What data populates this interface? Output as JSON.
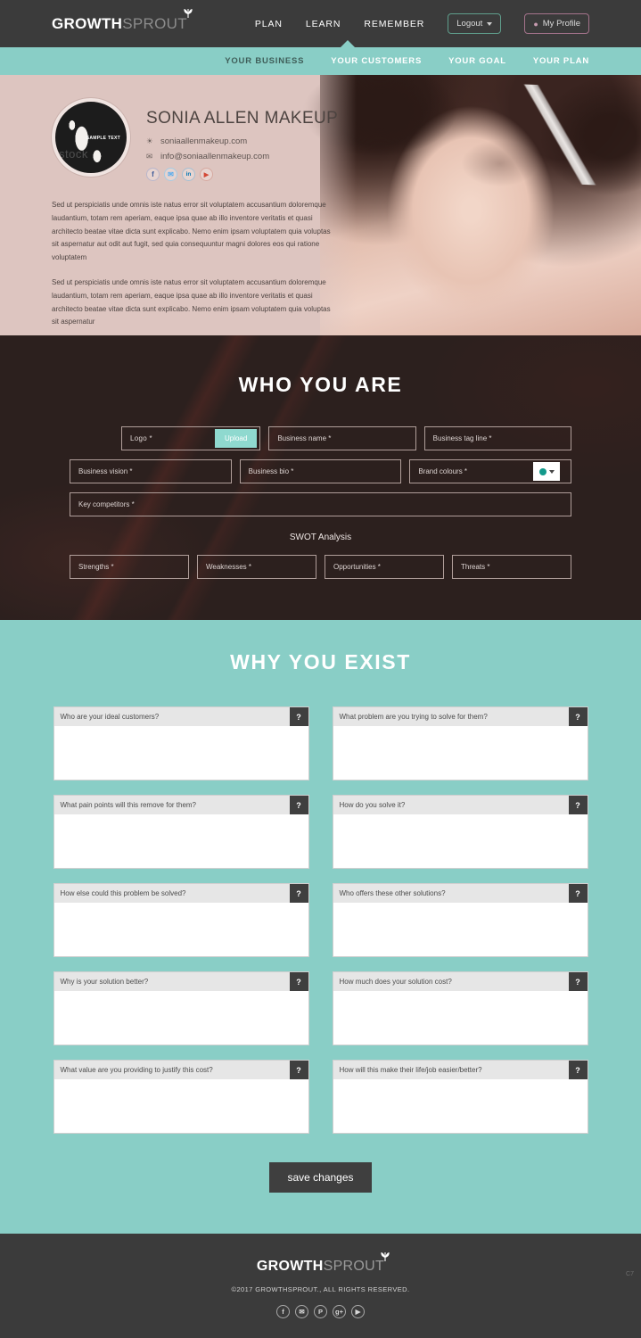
{
  "brand": {
    "logo_bold": "GROWTH",
    "logo_light": "SPROUT",
    "accent_teal": "#89cec6",
    "accent_dark": "#3b3b3b",
    "accent_maroon": "#2c201e",
    "swatch_color": "#12998b"
  },
  "topnav": {
    "links": [
      {
        "label": "PLAN",
        "active": true
      },
      {
        "label": "LEARN",
        "active": false
      },
      {
        "label": "REMEMBER",
        "active": false
      }
    ],
    "logout_label": "Logout",
    "profile_label": "My Profile"
  },
  "subnav": {
    "items": [
      {
        "label": "YOUR BUSINESS",
        "active": true
      },
      {
        "label": "YOUR CUSTOMERS",
        "active": false
      },
      {
        "label": "YOUR GOAL",
        "active": false
      },
      {
        "label": "YOUR PLAN",
        "active": false
      }
    ]
  },
  "profile": {
    "business_name": "SONIA ALLEN MAKEUP",
    "website": "soniaallenmakeup.com",
    "email": "info@soniaallenmakeup.com",
    "avatar_sample_text": "SAMPLE TEXT",
    "socials": [
      {
        "name": "facebook",
        "glyph": "f"
      },
      {
        "name": "twitter",
        "glyph": "✉"
      },
      {
        "name": "linkedin",
        "glyph": "in"
      },
      {
        "name": "youtube",
        "glyph": "▶"
      }
    ],
    "paragraphs": [
      "Sed ut perspiciatis unde omnis iste natus error sit voluptatem accusantium doloremque laudantium, totam rem aperiam, eaque ipsa quae ab illo inventore veritatis et quasi architecto beatae vitae dicta sunt explicabo. Nemo enim ipsam voluptatem quia voluptas sit aspernatur aut odit aut fugit, sed quia consequuntur magni dolores eos qui ratione voluptatem",
      "Sed ut perspiciatis unde omnis iste natus error sit voluptatem accusantium doloremque laudantium, totam rem aperiam, eaque ipsa quae ab illo inventore veritatis et quasi architecto beatae vitae dicta sunt explicabo. Nemo enim ipsam voluptatem quia voluptas sit aspernatur"
    ]
  },
  "who_you_are": {
    "title": "WHO YOU ARE",
    "fields": {
      "logo": "Logo *",
      "upload_label": "Upload",
      "business_name": "Business name *",
      "business_tag_line": "Business tag line *",
      "business_vision": "Business vision *",
      "business_bio": "Business bio *",
      "brand_colours": "Brand colours *",
      "key_competitors": "Key competitors *"
    },
    "swot_label": "SWOT Analysis",
    "swot": [
      "Strengths *",
      "Weaknesses *",
      "Opportunities *",
      "Threats *"
    ]
  },
  "why_you_exist": {
    "title": "WHY YOU EXIST",
    "help_glyph": "?",
    "questions": [
      "Who are your ideal customers?",
      "What problem are you trying to solve for them?",
      "What pain points will this remove for them?",
      "How do you solve it?",
      "How else could this problem be solved?",
      "Who offers these other solutions?",
      "Why is your solution better?",
      "How much does your solution cost?",
      "What value are you providing to justify this cost?",
      "How will this make their life/job easier/better?"
    ],
    "answers": [
      "",
      "",
      "",
      "",
      "",
      "",
      "",
      "",
      "",
      ""
    ],
    "save_label": "save changes"
  },
  "footer": {
    "logo_bold": "GROWTH",
    "logo_light": "SPROUT",
    "copyright": "©2017 GROWTHSPROUT., ALL RIGHTS RESERVED.",
    "socials": [
      {
        "name": "facebook",
        "glyph": "f"
      },
      {
        "name": "twitter",
        "glyph": "✉"
      },
      {
        "name": "pinterest",
        "glyph": "P"
      },
      {
        "name": "googleplus",
        "glyph": "g+"
      },
      {
        "name": "youtube",
        "glyph": "▶"
      }
    ],
    "corner_mark": "C7"
  }
}
